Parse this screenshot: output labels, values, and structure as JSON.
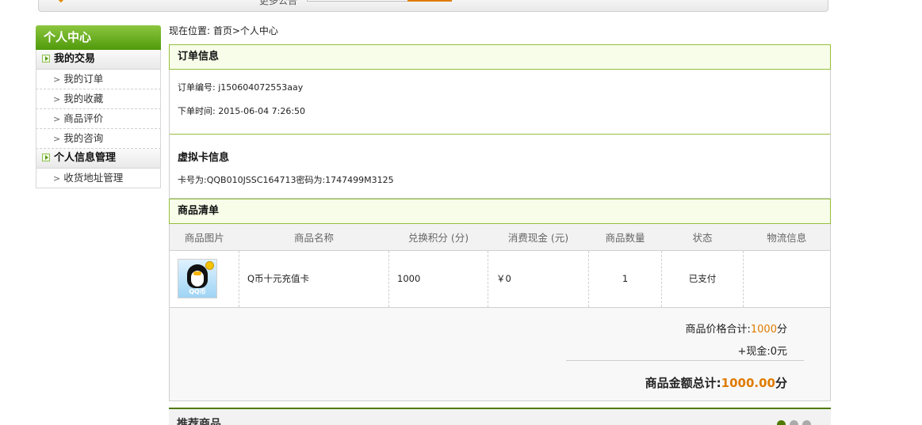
{
  "topbar": {
    "more_label": "更多公告"
  },
  "sidebar": {
    "title": "个人中心",
    "group1": "我的交易",
    "group1_items": [
      "我的订单",
      "我的收藏",
      "商品评价",
      "我的咨询"
    ],
    "group2": "个人信息管理",
    "group2_items": [
      "收货地址管理"
    ]
  },
  "breadcrumb": "现在位置: 首页>个人中心",
  "order": {
    "section_title": "订单信息",
    "number": "订单编号: j150604072553aay",
    "time": "下单时间: 2015-06-04 7:26:50"
  },
  "vcard": {
    "title": "虚拟卡信息",
    "line": "卡号为:QQB010JSSC164713密码为:1747499M3125"
  },
  "goods": {
    "section_title": "商品清单",
    "columns": [
      "商品图片",
      "商品名称",
      "兑换积分 (分)",
      "消费现金 (元)",
      "商品数量",
      "状态",
      "物流信息"
    ],
    "rows": [
      {
        "name": "Q币十元充值卡",
        "points": "1000",
        "cash": "￥0",
        "qty": "1",
        "status": "已支付",
        "logistics": "",
        "thumb_label": "QQ币"
      }
    ]
  },
  "totals": {
    "price_label": "商品价格合计:",
    "price_value": "1000",
    "price_unit": "分",
    "cash_label": "+现金:",
    "cash_value": "0元",
    "grand_label": "商品金额总计:",
    "grand_value": "1000.00",
    "grand_unit": "分"
  },
  "recommend": {
    "title": "推荐商品"
  },
  "colors": {
    "accent_green": "#5a9a1a",
    "accent_orange": "#e07b00"
  }
}
